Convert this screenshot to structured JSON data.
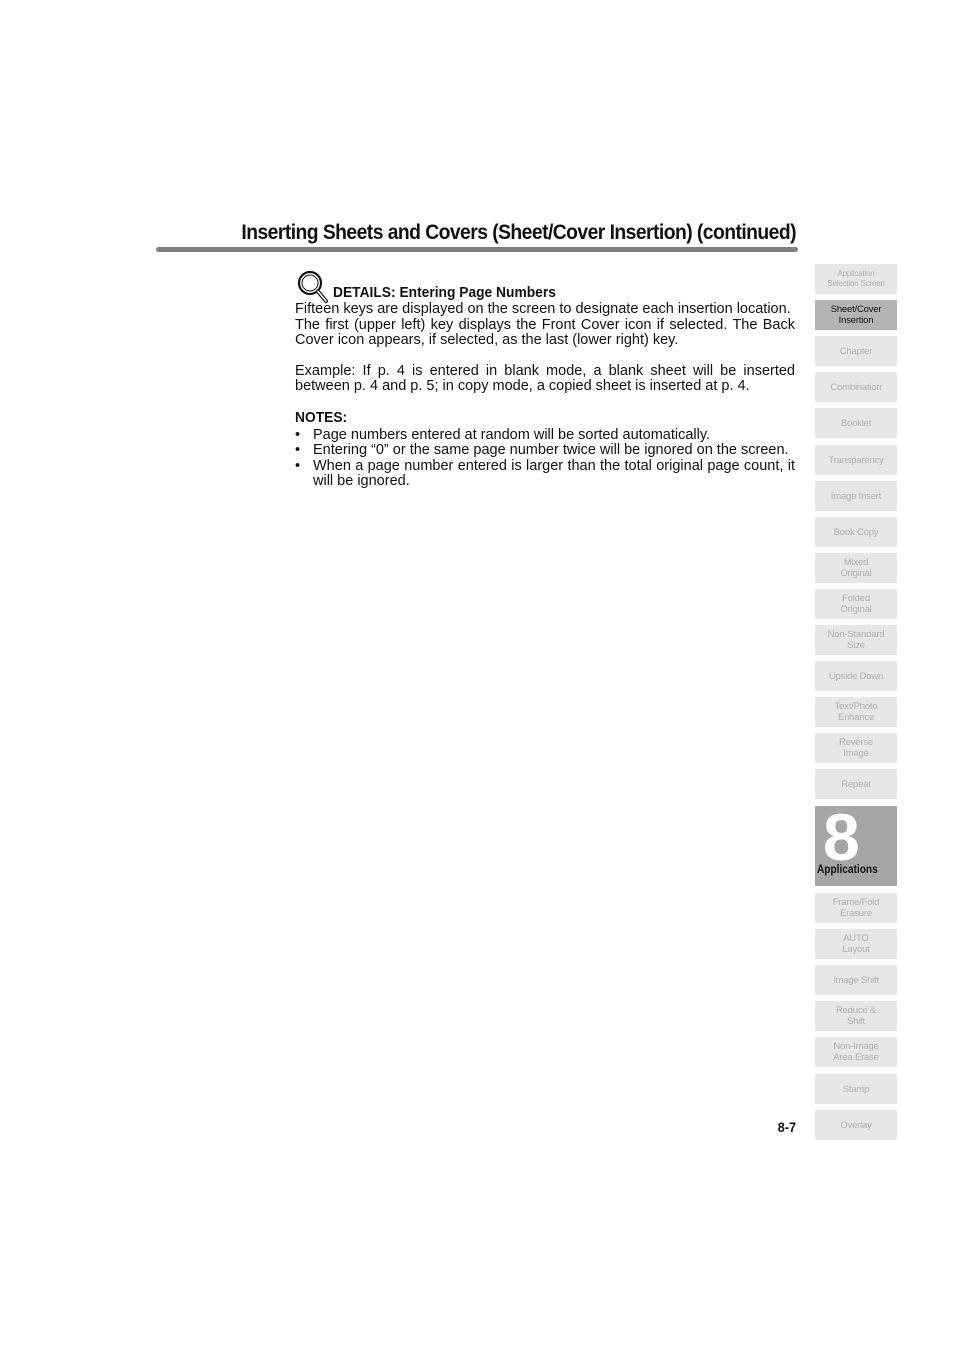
{
  "header": {
    "title": "Inserting Sheets and Covers (Sheet/Cover Insertion) (continued)"
  },
  "details": {
    "icon": "magnifier-icon",
    "title": "DETAILS: Entering Page Numbers",
    "paragraphs": [
      "Fifteen keys are displayed on the screen to designate each insertion location.",
      "The first (upper left) key displays the Front Cover icon if selected. The Back Cover icon appears, if selected, as the last (lower right) key.",
      "Example: If p. 4 is entered in blank mode, a blank sheet will be inserted between p. 4 and p. 5; in copy mode, a copied sheet is inserted at p. 4."
    ]
  },
  "notes": {
    "title": "NOTES:",
    "bullet": "•",
    "items": [
      "Page numbers entered at random will be sorted automatically.",
      "Entering “0” or the same page number twice will be ignored on the screen.",
      "When a page number entered is larger than the total original page count, it will be ignored."
    ]
  },
  "page_number": "8-7",
  "sidebar": {
    "tabs_top": [
      {
        "label": "Application\nSelection Screen",
        "active": false
      },
      {
        "label": "Sheet/Cover\nInsertion",
        "active": true
      },
      {
        "label": "Chapter",
        "active": false
      },
      {
        "label": "Combination",
        "active": false
      },
      {
        "label": "Booklet",
        "active": false
      },
      {
        "label": "Transparency",
        "active": false
      },
      {
        "label": "Image Insert",
        "active": false
      },
      {
        "label": "Book Copy",
        "active": false
      },
      {
        "label": "Mixed\nOriginal",
        "active": false
      },
      {
        "label": "Folded\nOriginal",
        "active": false
      },
      {
        "label": "Non-Standard\nSize",
        "active": false
      },
      {
        "label": "Upside Down",
        "active": false
      },
      {
        "label": "Text/Photo\nEnhance",
        "active": false
      },
      {
        "label": "Reverse\nImage",
        "active": false
      },
      {
        "label": "Repeat",
        "active": false
      }
    ],
    "chapter": {
      "number": "8",
      "label": "Applications"
    },
    "tabs_bottom": [
      {
        "label": "Frame/Fold\nErasure"
      },
      {
        "label": "AUTO\nLayout"
      },
      {
        "label": "Image Shift"
      },
      {
        "label": "Reduce &\nShift"
      },
      {
        "label": "Non-Image\nArea Erase"
      },
      {
        "label": "Stamp"
      },
      {
        "label": "Overlay"
      }
    ]
  }
}
